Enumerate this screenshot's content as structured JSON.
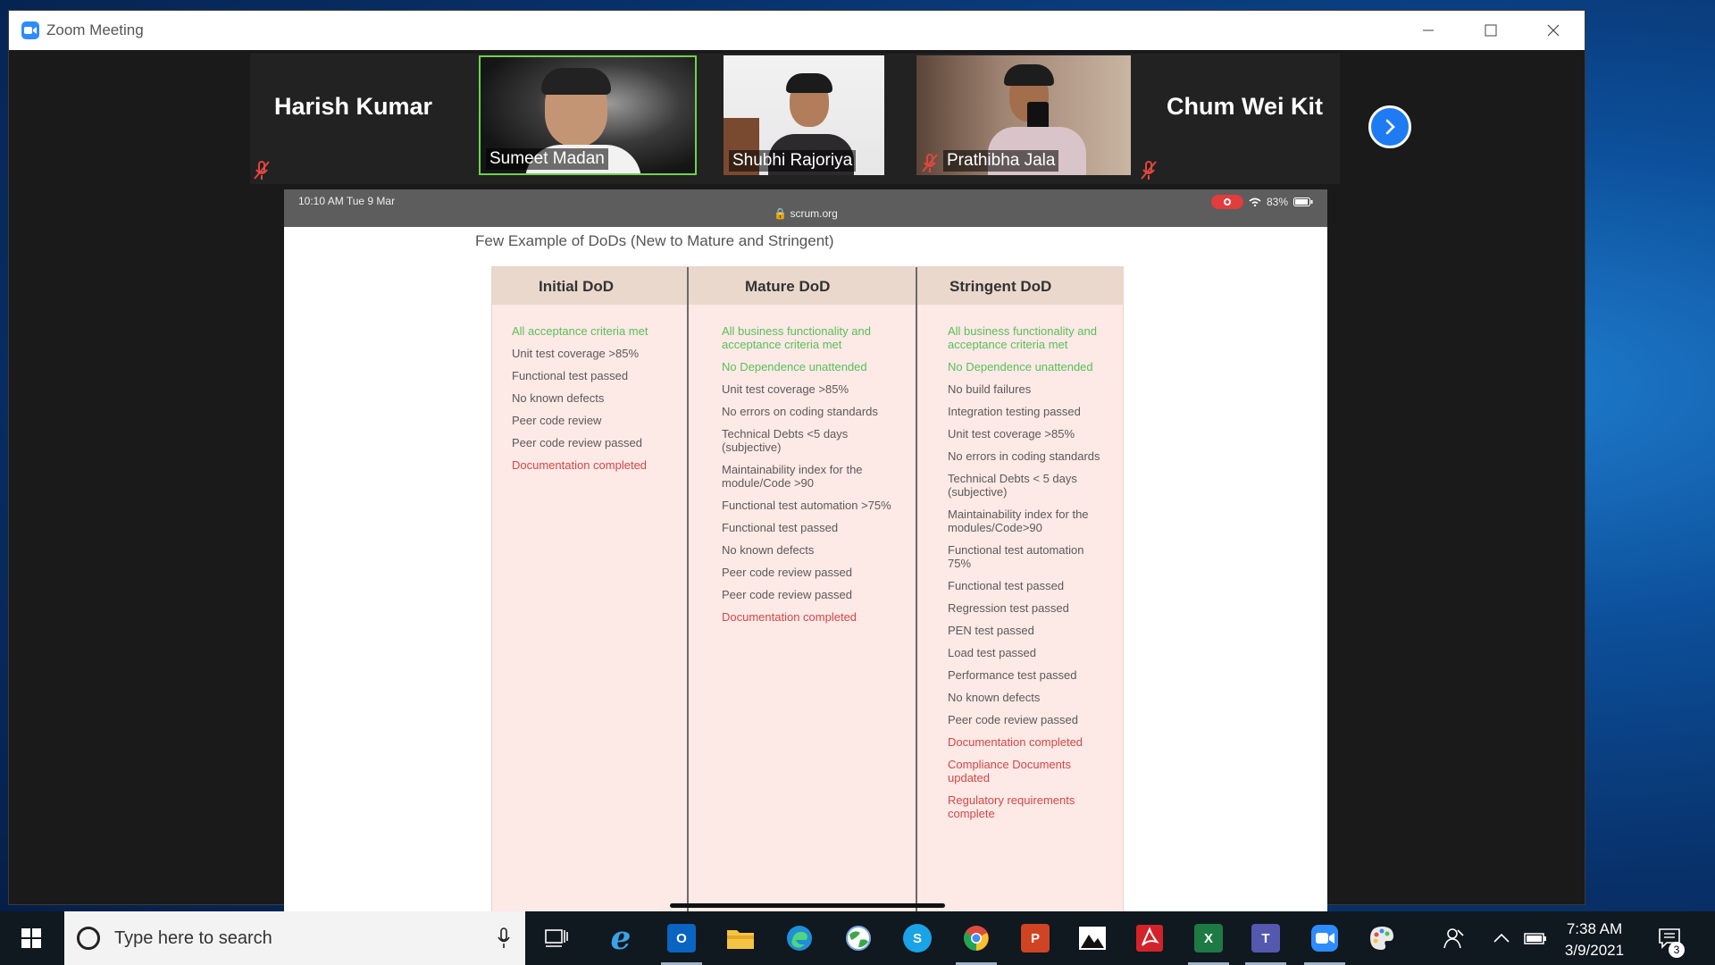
{
  "window": {
    "title": "Zoom Meeting"
  },
  "participants": {
    "left_name": "Harish Kumar",
    "right_name": "Chum Wei Kit",
    "tiles": [
      {
        "name": "Sumeet Madan"
      },
      {
        "name": "Shubhi Rajoriya"
      },
      {
        "name": "Prathibha Jala"
      }
    ]
  },
  "share": {
    "ipad_time": "10:10 AM   Tue 9 Mar",
    "url": "🔒 scrum.org",
    "battery": "83%",
    "slide_title": "Few Example of DoDs (New to Mature and Stringent)",
    "columns": [
      {
        "title": "Initial DoD",
        "items": [
          {
            "text": "All acceptance criteria met",
            "tone": "green"
          },
          {
            "text": "Unit test coverage >85%",
            "tone": "normal"
          },
          {
            "text": "Functional test passed",
            "tone": "normal"
          },
          {
            "text": "No known defects",
            "tone": "normal"
          },
          {
            "text": "Peer code review",
            "tone": "normal"
          },
          {
            "text": "Peer code review passed",
            "tone": "normal"
          },
          {
            "text": "Documentation completed",
            "tone": "red"
          }
        ]
      },
      {
        "title": "Mature DoD",
        "items": [
          {
            "text": "All business functionality and acceptance criteria  met",
            "tone": "green"
          },
          {
            "text": "No Dependence unattended",
            "tone": "green"
          },
          {
            "text": "Unit test coverage >85%",
            "tone": "normal"
          },
          {
            "text": "No errors on coding standards",
            "tone": "normal"
          },
          {
            "text": "Technical Debts <5 days (subjective)",
            "tone": "normal"
          },
          {
            "text": "Maintainability index for the module/Code >90",
            "tone": "normal"
          },
          {
            "text": "Functional test automation >75%",
            "tone": "normal"
          },
          {
            "text": "Functional test passed",
            "tone": "normal"
          },
          {
            "text": "No known defects",
            "tone": "normal"
          },
          {
            "text": "Peer code review passed",
            "tone": "normal"
          },
          {
            "text": "Peer code review passed",
            "tone": "normal"
          },
          {
            "text": "Documentation completed",
            "tone": "red"
          }
        ]
      },
      {
        "title": "Stringent DoD",
        "items": [
          {
            "text": "All business functionality and acceptance criteria met",
            "tone": "green"
          },
          {
            "text": "No Dependence unattended",
            "tone": "green"
          },
          {
            "text": "No build failures",
            "tone": "normal"
          },
          {
            "text": "Integration testing passed",
            "tone": "normal"
          },
          {
            "text": "Unit test coverage >85%",
            "tone": "normal"
          },
          {
            "text": "No errors in coding standards",
            "tone": "normal"
          },
          {
            "text": "Technical Debts < 5 days (subjective)",
            "tone": "normal"
          },
          {
            "text": "Maintainability index for the modules/Code>90",
            "tone": "normal"
          },
          {
            "text": "Functional test automation 75%",
            "tone": "normal"
          },
          {
            "text": "Functional test passed",
            "tone": "normal"
          },
          {
            "text": "Regression test passed",
            "tone": "normal"
          },
          {
            "text": "PEN test passed",
            "tone": "normal"
          },
          {
            "text": "Load test passed",
            "tone": "normal"
          },
          {
            "text": "Performance test passed",
            "tone": "normal"
          },
          {
            "text": "No known defects",
            "tone": "normal"
          },
          {
            "text": "Peer code review passed",
            "tone": "normal"
          },
          {
            "text": "Documentation completed",
            "tone": "red"
          },
          {
            "text": "Compliance Documents updated",
            "tone": "red"
          },
          {
            "text": "Regulatory requirements complete",
            "tone": "red"
          }
        ]
      }
    ]
  },
  "taskbar": {
    "search_placeholder": "Type here to search",
    "time": "7:38 AM",
    "date": "3/9/2021",
    "notification_count": "3",
    "apps": [
      {
        "name": "task-view",
        "label": ""
      },
      {
        "name": "internet-explorer",
        "label": "e"
      },
      {
        "name": "outlook",
        "label": "O"
      },
      {
        "name": "file-explorer",
        "label": ""
      },
      {
        "name": "edge",
        "label": ""
      },
      {
        "name": "globe-app",
        "label": ""
      },
      {
        "name": "skype",
        "label": "S"
      },
      {
        "name": "chrome",
        "label": ""
      },
      {
        "name": "powerpoint",
        "label": "P"
      },
      {
        "name": "photos",
        "label": ""
      },
      {
        "name": "acrobat",
        "label": ""
      },
      {
        "name": "excel",
        "label": "X"
      },
      {
        "name": "teams",
        "label": "T"
      },
      {
        "name": "zoom",
        "label": ""
      },
      {
        "name": "paint",
        "label": ""
      }
    ]
  },
  "colors": {
    "accent": "#2d8cff",
    "slide_green": "#58c05a",
    "slide_red": "#d14848",
    "table_bg": "#fde9e6"
  }
}
